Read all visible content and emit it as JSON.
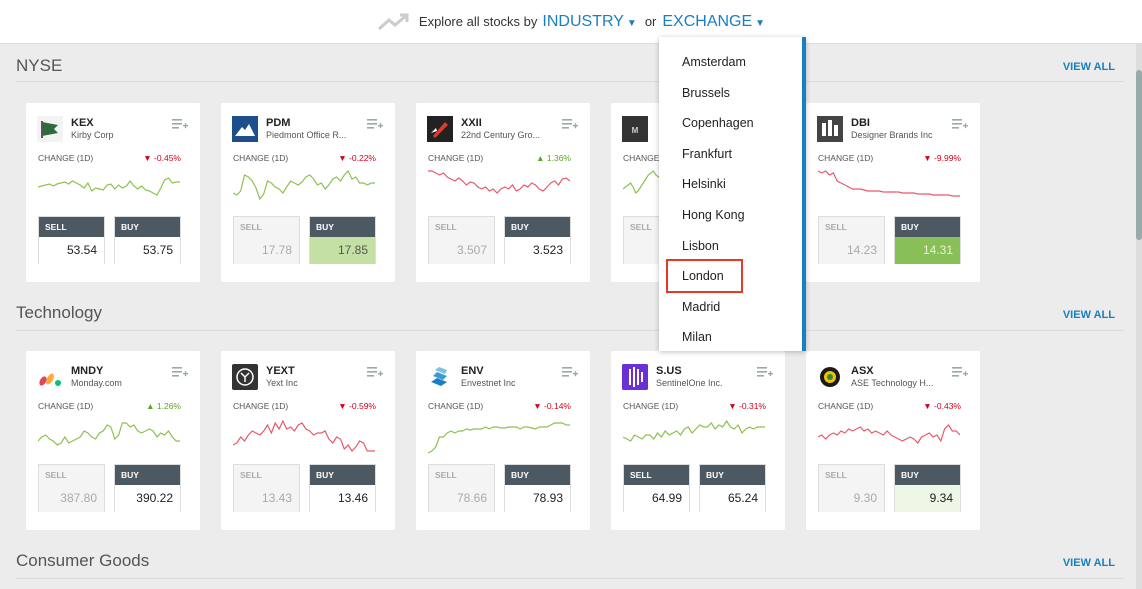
{
  "header": {
    "explore_text": "Explore all stocks by",
    "industry_label": "INDUSTRY",
    "or_text": "or",
    "exchange_label": "EXCHANGE"
  },
  "common": {
    "change_label": "CHANGE (1D)",
    "sell_label": "SELL",
    "buy_label": "BUY",
    "view_all": "VIEW ALL"
  },
  "sections": [
    {
      "title": "NYSE",
      "cards": [
        {
          "symbol": "KEX",
          "name": "Kirby Corp",
          "change": "-0.45%",
          "direction": "down",
          "sell": "53.54",
          "buy": "53.75",
          "sell_style": "dark",
          "buy_style": "dark",
          "logo_icon": "flag-icon",
          "logo_color": "#2e6b3a",
          "spark_color": "#8cc152",
          "spark": [
            18,
            17,
            16,
            15,
            17,
            15,
            14,
            13,
            15,
            12,
            14,
            16,
            19,
            14,
            22,
            19,
            20,
            21,
            16,
            15,
            20,
            16,
            19,
            17,
            12,
            17,
            20,
            17,
            21,
            22,
            24,
            26,
            19,
            11,
            9,
            14,
            13,
            13
          ]
        },
        {
          "symbol": "PDM",
          "name": "Piedmont Office R...",
          "change": "-0.22%",
          "direction": "down",
          "sell": "17.78",
          "buy": "17.85",
          "sell_style": "muted",
          "buy_style": "green",
          "logo_icon": "mountain-icon",
          "logo_color": "#1f4e8c",
          "spark_color": "#8cc152",
          "spark": [
            24,
            26,
            22,
            6,
            8,
            12,
            19,
            30,
            25,
            12,
            14,
            18,
            20,
            24,
            18,
            12,
            14,
            16,
            13,
            8,
            6,
            10,
            16,
            14,
            20,
            16,
            10,
            8,
            12,
            6,
            2,
            10,
            8,
            14,
            14,
            16,
            14,
            14
          ]
        },
        {
          "symbol": "XXII",
          "name": "22nd Century Gro...",
          "change": "1.36%",
          "direction": "up",
          "sell": "3.507",
          "buy": "3.523",
          "sell_style": "muted",
          "buy_style": "dark",
          "logo_icon": "rocket-icon",
          "logo_color": "#222222",
          "spark_color": "#e85a6a",
          "spark": [
            2,
            2,
            4,
            6,
            4,
            8,
            10,
            12,
            9,
            12,
            16,
            13,
            14,
            18,
            20,
            18,
            22,
            20,
            24,
            20,
            18,
            20,
            16,
            22,
            20,
            16,
            18,
            14,
            16,
            20,
            22,
            18,
            14,
            12,
            16,
            10,
            9,
            12
          ]
        },
        {
          "symbol": "",
          "name": "",
          "change": "",
          "direction": "up",
          "sell": "",
          "buy": "",
          "sell_style": "muted",
          "buy_style": "dark",
          "logo_icon": "letters-icon",
          "logo_color": "#333333",
          "spark_color": "#8cc152",
          "spark": [
            20,
            18,
            16,
            14,
            18,
            24,
            22,
            18,
            14,
            10,
            6,
            4,
            2,
            6,
            8,
            10
          ]
        },
        {
          "symbol": "DBI",
          "name": "Designer Brands Inc",
          "change": "-9.99%",
          "direction": "down",
          "sell": "14.23",
          "buy": "14.31",
          "sell_style": "muted",
          "buy_style": "green2",
          "logo_icon": "building-icon",
          "logo_color": "#444444",
          "spark_color": "#e85a6a",
          "spark": [
            2,
            4,
            2,
            6,
            4,
            12,
            14,
            16,
            18,
            20,
            20,
            20,
            21,
            22,
            22,
            22,
            22,
            23,
            23,
            23,
            23,
            23,
            24,
            24,
            24,
            24,
            25,
            25,
            25,
            25,
            26,
            26,
            26,
            26,
            26,
            27,
            27,
            27
          ]
        }
      ]
    },
    {
      "title": "Technology",
      "cards": [
        {
          "symbol": "MNDY",
          "name": "Monday.com",
          "change": "1.26%",
          "direction": "up",
          "sell": "387.80",
          "buy": "390.22",
          "sell_style": "muted",
          "buy_style": "dark",
          "logo_icon": "monday-icon",
          "logo_color": "#ffffff",
          "spark_color": "#8cc152",
          "spark": [
            24,
            20,
            18,
            22,
            24,
            28,
            26,
            20,
            26,
            24,
            22,
            20,
            14,
            16,
            20,
            22,
            16,
            14,
            8,
            10,
            22,
            18,
            6,
            6,
            10,
            8,
            14,
            16,
            14,
            12,
            14,
            20,
            16,
            18,
            14,
            20,
            24,
            24
          ]
        },
        {
          "symbol": "YEXT",
          "name": "Yext Inc",
          "change": "-0.59%",
          "direction": "down",
          "sell": "13.43",
          "buy": "13.46",
          "sell_style": "muted",
          "buy_style": "dark",
          "logo_icon": "yext-icon",
          "logo_color": "#333333",
          "spark_color": "#e85a6a",
          "spark": [
            28,
            26,
            20,
            24,
            18,
            14,
            16,
            18,
            14,
            8,
            16,
            6,
            12,
            4,
            12,
            10,
            14,
            8,
            6,
            12,
            14,
            18,
            16,
            16,
            14,
            22,
            26,
            20,
            22,
            32,
            28,
            34,
            30,
            24,
            26,
            34,
            34,
            34
          ]
        },
        {
          "symbol": "ENV",
          "name": "Envestnet Inc",
          "change": "-0.14%",
          "direction": "down",
          "sell": "78.66",
          "buy": "78.93",
          "sell_style": "muted",
          "buy_style": "dark",
          "logo_icon": "stack-icon",
          "logo_color": "#ffffff",
          "spark_color": "#8cc152",
          "spark": [
            36,
            34,
            30,
            20,
            20,
            16,
            14,
            16,
            14,
            14,
            12,
            13,
            12,
            12,
            12,
            10,
            12,
            10,
            10,
            11,
            11,
            10,
            10,
            10,
            12,
            10,
            10,
            11,
            12,
            10,
            10,
            10,
            8,
            6,
            6,
            6,
            8,
            8
          ]
        },
        {
          "symbol": "S.US",
          "name": "SentinelOne Inc.",
          "change": "-0.31%",
          "direction": "down",
          "sell": "64.99",
          "buy": "65.24",
          "sell_style": "dark",
          "buy_style": "dark",
          "logo_icon": "sentinel-icon",
          "logo_color": "#6b2fd6",
          "spark_color": "#8cc152",
          "spark": [
            20,
            22,
            24,
            18,
            20,
            22,
            18,
            18,
            22,
            16,
            20,
            14,
            18,
            16,
            14,
            18,
            12,
            10,
            16,
            12,
            8,
            10,
            10,
            6,
            12,
            8,
            10,
            4,
            10,
            12,
            8,
            16,
            12,
            10,
            12,
            10,
            10,
            10
          ]
        },
        {
          "symbol": "ASX",
          "name": "ASE Technology H...",
          "change": "-0.43%",
          "direction": "down",
          "sell": "9.30",
          "buy": "9.34",
          "sell_style": "muted",
          "buy_style": "light",
          "logo_icon": "gear-icon",
          "logo_color": "#ffffff",
          "spark_color": "#e85a6a",
          "spark": [
            20,
            18,
            22,
            18,
            16,
            18,
            14,
            16,
            12,
            14,
            12,
            10,
            14,
            12,
            16,
            14,
            16,
            18,
            14,
            18,
            20,
            22,
            24,
            22,
            20,
            22,
            26,
            20,
            18,
            16,
            20,
            18,
            24,
            12,
            8,
            14,
            14,
            18
          ]
        }
      ]
    },
    {
      "title": "Consumer Goods",
      "cards": []
    }
  ],
  "exchange_dropdown": {
    "items": [
      "Amsterdam",
      "Brussels",
      "Copenhagen",
      "Frankfurt",
      "Helsinki",
      "Hong Kong",
      "Lisbon",
      "London",
      "Madrid",
      "Milan"
    ],
    "highlighted": "London"
  },
  "colors": {
    "accent": "#1a7fc0",
    "positive": "#5ba52b",
    "negative": "#d0021b",
    "highlight_border": "#e33b2a"
  }
}
